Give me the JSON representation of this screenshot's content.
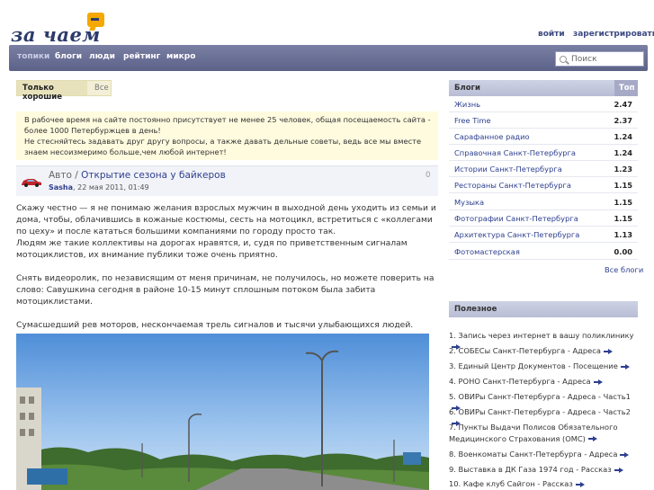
{
  "header": {
    "logo_text": "за чаем",
    "login": "войти",
    "register": "зарегистрироваться"
  },
  "nav": {
    "items": [
      "топики",
      "блоги",
      "люди",
      "рейтинг",
      "микро"
    ],
    "search_placeholder": "Поиск"
  },
  "filter": {
    "good": "Только хорошие",
    "all": "Все"
  },
  "info": {
    "line1": "В рабочее время на сайте постоянно присутствует не менее 25 человек, общая посещаемость сайта - более 1000 Петербуржцев в день!",
    "line2": "Не стесняйтесь задавать друг другу вопросы, а также давать дельные советы, ведь все мы вместе знаем несоизмеримо больше,чем любой интернет!"
  },
  "post": {
    "category": "Авто",
    "title": "Открытие сезона у байкеров",
    "author": "Sasha",
    "date": "22 мая 2011, 01:49",
    "count": "0",
    "paragraphs": [
      "Скажу честно — я не понимаю желания взрослых мужчин в выходной день уходить из семьи и дома, чтобы, облачившись в кожаные костюмы, сесть на мотоцикл, встретиться с «коллегами по цеху» и после кататься большими компаниями по городу просто так.",
      "Людям же такие коллективы на дорогах нравятся, и, судя по приветственным сигналам мотоциклистов, их внимание публики тоже очень приятно.",
      "Снять видеоролик, по независящим от меня причинам, не получилось, но можете поверить на слово: Савушкина сегодня в районе 10-15 минут сплошным потоком была забита мотоциклистами.",
      "Сумасшедший рев моторов, нескончаемая трель сигналов и тысячи улыбающихся людей."
    ]
  },
  "blogs": {
    "title": "Блоги",
    "top_label": "Топ",
    "all_label": "Все блоги",
    "items": [
      {
        "name": "Жизнь",
        "score": "2.47"
      },
      {
        "name": "Free Time",
        "score": "2.37"
      },
      {
        "name": "Сарафанное радио",
        "score": "1.24"
      },
      {
        "name": "Справочная Санкт-Петербурга",
        "score": "1.24"
      },
      {
        "name": "Истории Санкт-Петербурга",
        "score": "1.23"
      },
      {
        "name": "Рестораны Санкт-Петербурга",
        "score": "1.15"
      },
      {
        "name": "Музыка",
        "score": "1.15"
      },
      {
        "name": "Фотографии Санкт-Петербурга",
        "score": "1.15"
      },
      {
        "name": "Архитектура Санкт-Петербурга",
        "score": "1.13"
      },
      {
        "name": "Фотомастерская",
        "score": "0.00"
      }
    ]
  },
  "useful": {
    "title": "Полезное",
    "items": [
      "1. Запись через интернет в вашу поликлинику",
      "2. СОБЕСы Санкт-Петербурга - Адреса",
      "3. Единый Центр Документов - Посещение",
      "4. РОНО Санкт-Петербурга - Адреса",
      "5. ОВИРы Санкт-Петербурга - Адреса - Часть1",
      "6. ОВИРы Санкт-Петербурга - Адреса - Часть2",
      "7. Пункты Выдачи Полисов Обязательного Медицинского Страхования (ОМС)",
      "8. Военкоматы Санкт-Петербурга - Адреса",
      "9. Выставка в ДК Газа 1974 год - Рассказ",
      "10. Кафе клуб Сайгон - Рассказ"
    ]
  },
  "colors": {
    "nav_bar": "#5d6289",
    "link": "#2d3f8f",
    "info_bg": "#fffbdf",
    "logo_cup": "#f5a800"
  }
}
